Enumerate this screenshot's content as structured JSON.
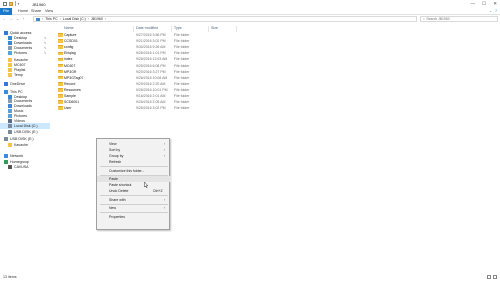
{
  "window": {
    "title": "JB1960",
    "minimize": "—",
    "maximize": "☐",
    "close": "✕"
  },
  "ribbon": {
    "tabs": [
      {
        "label": "File"
      },
      {
        "label": "Home"
      },
      {
        "label": "Share"
      },
      {
        "label": "View"
      }
    ],
    "expand_icon": "chevron-down-icon",
    "help_icon": "help-icon"
  },
  "address": {
    "back": "←",
    "forward": "→",
    "recent": "⌄",
    "up": "↑",
    "path": [
      "This PC",
      "Local Disk (C:)",
      "JB1960"
    ],
    "separator": "›",
    "search_placeholder": "Search JB1960"
  },
  "nav": {
    "items": [
      {
        "label": "Quick access",
        "icon": "star-icon",
        "color": "#2f7ad8",
        "pinned": false,
        "indent": 0
      },
      {
        "label": "Desktop",
        "icon": "desktop-icon",
        "color": "#3b86d6",
        "pinned": true,
        "indent": 1
      },
      {
        "label": "Downloads",
        "icon": "downloads-icon",
        "color": "#3b86d6",
        "pinned": true,
        "indent": 1
      },
      {
        "label": "Documents",
        "icon": "documents-icon",
        "color": "#8a9bb0",
        "pinned": true,
        "indent": 1
      },
      {
        "label": "Pictures",
        "icon": "pictures-icon",
        "color": "#5aa0d8",
        "pinned": true,
        "indent": 1
      },
      {
        "label": "Kavache",
        "icon": "folder-icon",
        "color": "#f3c34a",
        "pinned": false,
        "indent": 1
      },
      {
        "label": "MC607",
        "icon": "folder-icon",
        "color": "#f3c34a",
        "pinned": false,
        "indent": 1
      },
      {
        "label": "Playlist",
        "icon": "folder-icon",
        "color": "#f3c34a",
        "pinned": false,
        "indent": 1
      },
      {
        "label": "Temp",
        "icon": "folder-icon",
        "color": "#f3c34a",
        "pinned": false,
        "indent": 1
      },
      {
        "label": "OneDrive",
        "icon": "cloud-icon",
        "color": "#2f7ad8",
        "pinned": false,
        "indent": 0
      },
      {
        "label": "This PC",
        "icon": "computer-icon",
        "color": "#3a8ad6",
        "pinned": false,
        "indent": 0
      },
      {
        "label": "Desktop",
        "icon": "desktop-icon",
        "color": "#3b86d6",
        "pinned": false,
        "indent": 1
      },
      {
        "label": "Documents",
        "icon": "documents-icon",
        "color": "#8a9bb0",
        "pinned": false,
        "indent": 1
      },
      {
        "label": "Downloads",
        "icon": "downloads-icon",
        "color": "#3b86d6",
        "pinned": false,
        "indent": 1
      },
      {
        "label": "Music",
        "icon": "music-icon",
        "color": "#5aa0d8",
        "pinned": false,
        "indent": 1
      },
      {
        "label": "Pictures",
        "icon": "pictures-icon",
        "color": "#5aa0d8",
        "pinned": false,
        "indent": 1
      },
      {
        "label": "Videos",
        "icon": "videos-icon",
        "color": "#5a6e8c",
        "pinned": false,
        "indent": 1
      },
      {
        "label": "Local Disk (C:)",
        "icon": "drive-icon",
        "color": "#7a8a9a",
        "pinned": false,
        "indent": 1,
        "selected": true
      },
      {
        "label": "USB DISK (E:)",
        "icon": "usb-drive-icon",
        "color": "#7a8a9a",
        "pinned": false,
        "indent": 1
      },
      {
        "label": "USB DISK (E:)",
        "icon": "usb-drive-icon",
        "color": "#7a8a9a",
        "pinned": false,
        "indent": 0
      },
      {
        "label": "Kavache",
        "icon": "folder-icon",
        "color": "#f3c34a",
        "pinned": false,
        "indent": 1
      },
      {
        "label": "Network",
        "icon": "network-icon",
        "color": "#3a8ad6",
        "pinned": false,
        "indent": 0
      },
      {
        "label": "Homegroup",
        "icon": "homegroup-icon",
        "color": "#2f9a5a",
        "pinned": false,
        "indent": 0
      },
      {
        "label": "CAVUSA",
        "icon": "user-icon",
        "color": "#555555",
        "pinned": false,
        "indent": 1
      }
    ]
  },
  "columns": [
    "Name",
    "Date modified",
    "Type",
    "Size"
  ],
  "files": [
    {
      "name": "Capture",
      "date": "9/27/2016 3:56 PM",
      "type": "File folder"
    },
    {
      "name": "CCSD01",
      "date": "9/21/2016 3:02 PM",
      "type": "File folder"
    },
    {
      "name": "config",
      "date": "9/30/2016 9:26 AM",
      "type": "File folder"
    },
    {
      "name": "Ehiqiag",
      "date": "9/26/2016 1:01 PM",
      "type": "File folder"
    },
    {
      "name": "index",
      "date": "9/26/2016 12:03 AM",
      "type": "File folder"
    },
    {
      "name": "MC607",
      "date": "9/25/2016 6:08 PM",
      "type": "File folder"
    },
    {
      "name": "MP3GR",
      "date": "9/20/2016 3:27 PM",
      "type": "File folder"
    },
    {
      "name": "MP3GTag07",
      "date": "9/26/2016 10:08 AM",
      "type": "File folder"
    },
    {
      "name": "Record",
      "date": "9/29/2016 2:20 AM",
      "type": "File folder"
    },
    {
      "name": "Resources",
      "date": "9/26/2016 10:01 PM",
      "type": "File folder"
    },
    {
      "name": "Sample",
      "date": "9/16/2016 2:01 AM",
      "type": "File folder"
    },
    {
      "name": "SCD6001",
      "date": "9/26/2016 2:05 AM",
      "type": "File folder"
    },
    {
      "name": "User",
      "date": "9/26/2016 3:02 PM",
      "type": "File folder"
    }
  ],
  "context_menu": {
    "items": [
      {
        "label": "View",
        "submenu": true
      },
      {
        "label": "Sort by",
        "submenu": true
      },
      {
        "label": "Group by",
        "submenu": true
      },
      {
        "label": "Refresh"
      },
      {
        "sep": true
      },
      {
        "label": "Customize this folder..."
      },
      {
        "sep": true
      },
      {
        "label": "Paste",
        "hover": true
      },
      {
        "label": "Paste shortcut"
      },
      {
        "label": "Undo Delete",
        "shortcut": "Ctrl+Z"
      },
      {
        "sep": true
      },
      {
        "label": "Share with",
        "submenu": true
      },
      {
        "sep": true
      },
      {
        "label": "New",
        "submenu": true
      },
      {
        "sep": true
      },
      {
        "label": "Properties"
      }
    ]
  },
  "status": {
    "count": "13 items"
  },
  "colors": {
    "accent": "#1979ca",
    "folder": "#f3c34a",
    "selection": "#cce8ff",
    "menu_bg": "#f2f2f2"
  }
}
